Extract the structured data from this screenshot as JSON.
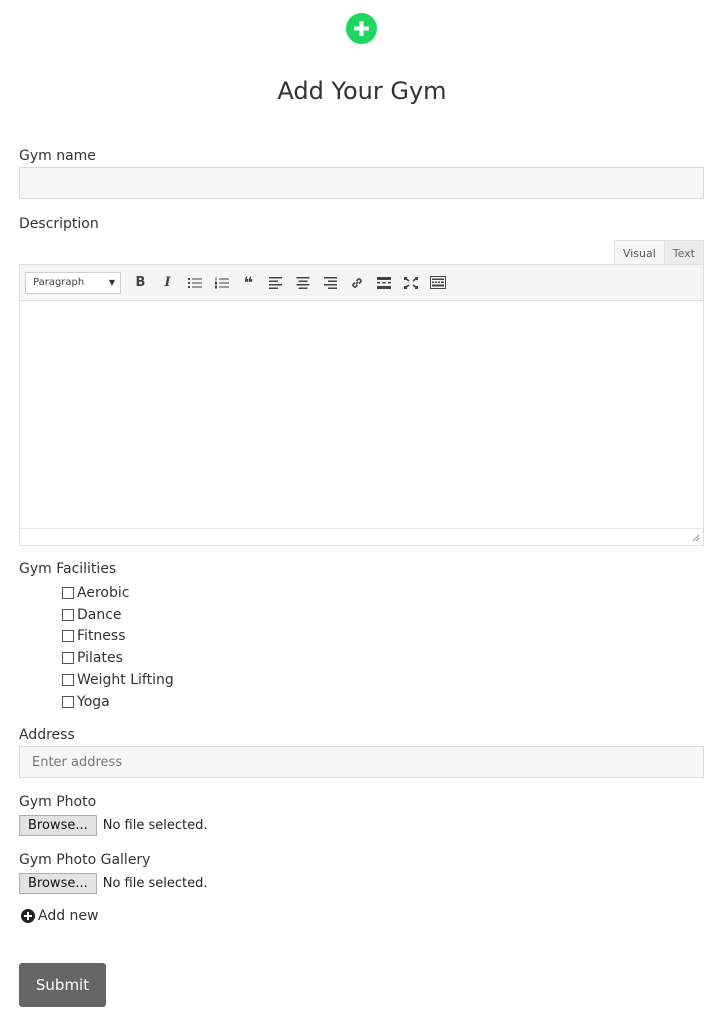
{
  "page": {
    "title": "Add Your Gym"
  },
  "form": {
    "gym_name": {
      "label": "Gym name",
      "value": "",
      "placeholder": ""
    },
    "description": {
      "label": "Description",
      "tabs": [
        {
          "label": "Visual",
          "active": true
        },
        {
          "label": "Text",
          "active": false
        }
      ],
      "format_select": "Paragraph",
      "toolbar_icons": [
        "bold-icon",
        "italic-icon",
        "bulleted-list-icon",
        "numbered-list-icon",
        "blockquote-icon",
        "align-left-icon",
        "align-center-icon",
        "align-right-icon",
        "link-icon",
        "read-more-icon",
        "fullscreen-icon",
        "toolbar-toggle-icon"
      ],
      "toolbar_bold": "B",
      "toolbar_italic": "I",
      "toolbar_blockquote": "❝",
      "content": ""
    },
    "facilities": {
      "label": "Gym Facilities",
      "options": [
        {
          "label": "Aerobic",
          "checked": false
        },
        {
          "label": "Dance",
          "checked": false
        },
        {
          "label": "Fitness",
          "checked": false
        },
        {
          "label": "Pilates",
          "checked": false
        },
        {
          "label": "Weight Lifting",
          "checked": false
        },
        {
          "label": "Yoga",
          "checked": false
        }
      ]
    },
    "address": {
      "label": "Address",
      "value": "",
      "placeholder": "Enter address"
    },
    "gym_photo": {
      "label": "Gym Photo",
      "button": "Browse...",
      "status": "No file selected."
    },
    "gym_photo_gallery": {
      "label": "Gym Photo Gallery",
      "button": "Browse...",
      "status": "No file selected."
    },
    "add_new": {
      "label": "Add new"
    },
    "submit": {
      "label": "Submit"
    }
  },
  "colors": {
    "accent_green": "#1ed760",
    "submit_bg": "#666666",
    "input_bg": "#f7f7f7",
    "input_border": "#dcdcdc"
  }
}
